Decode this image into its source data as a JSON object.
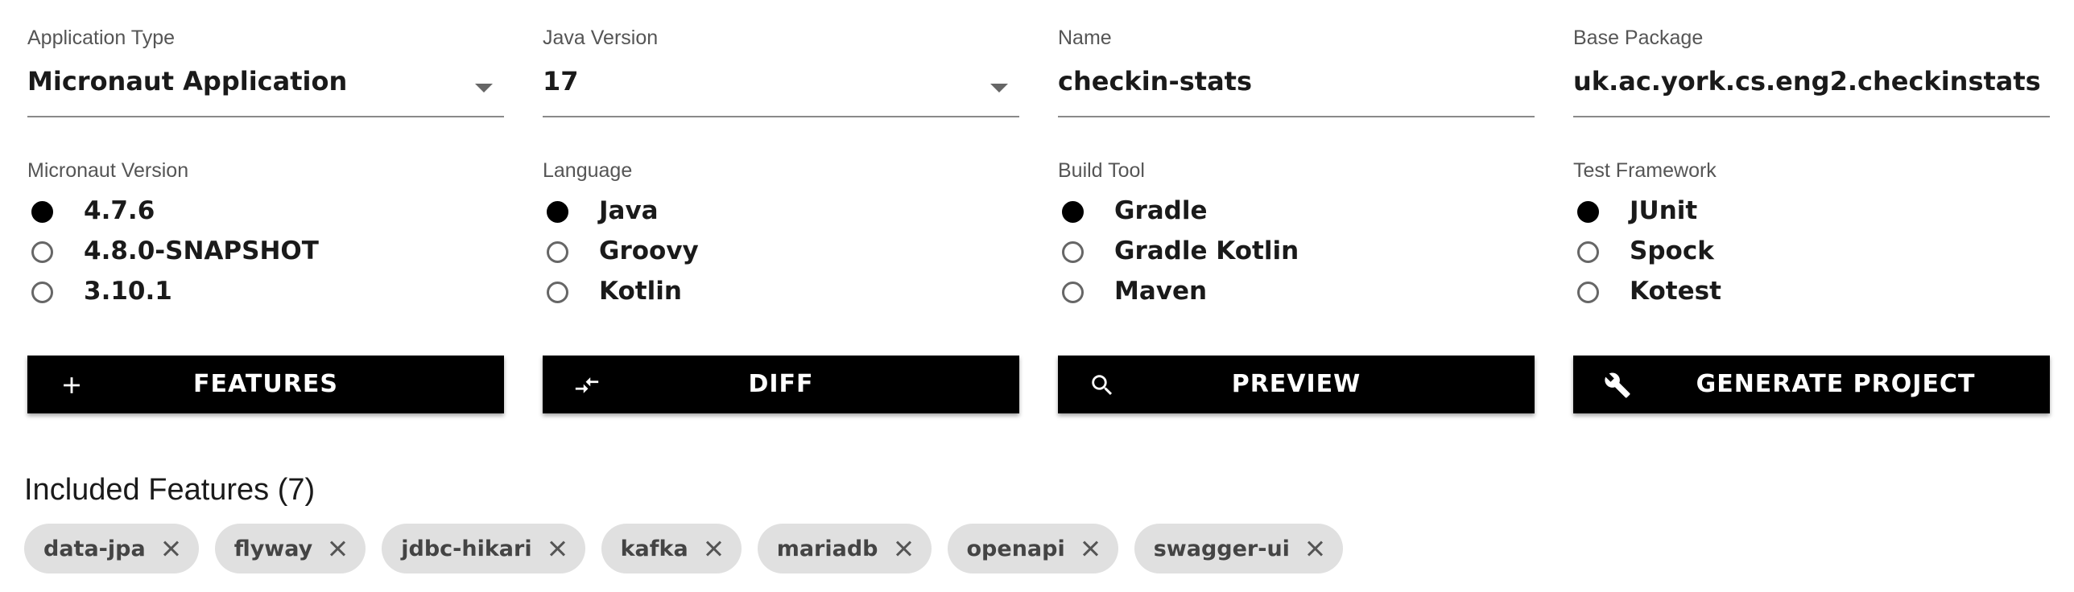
{
  "fields": {
    "application_type": {
      "label": "Application Type",
      "value": "Micronaut Application"
    },
    "java_version": {
      "label": "Java Version",
      "value": "17"
    },
    "name": {
      "label": "Name",
      "value": "checkin-stats"
    },
    "base_package": {
      "label": "Base Package",
      "value": "uk.ac.york.cs.eng2.checkinstats"
    }
  },
  "groups": {
    "micronaut_version": {
      "label": "Micronaut Version",
      "selected": "4.7.6",
      "options": [
        "4.7.6",
        "4.8.0-SNAPSHOT",
        "3.10.1"
      ]
    },
    "language": {
      "label": "Language",
      "selected": "Java",
      "options": [
        "Java",
        "Groovy",
        "Kotlin"
      ]
    },
    "build_tool": {
      "label": "Build Tool",
      "selected": "Gradle",
      "options": [
        "Gradle",
        "Gradle Kotlin",
        "Maven"
      ]
    },
    "test_framework": {
      "label": "Test Framework",
      "selected": "JUnit",
      "options": [
        "JUnit",
        "Spock",
        "Kotest"
      ]
    }
  },
  "actions": {
    "features": {
      "label": "FEATURES",
      "icon": "plus-icon"
    },
    "diff": {
      "label": "DIFF",
      "icon": "compare-arrows-icon"
    },
    "preview": {
      "label": "PREVIEW",
      "icon": "search-icon"
    },
    "generate": {
      "label": "GENERATE PROJECT",
      "icon": "wrench-icon"
    }
  },
  "included": {
    "title": "Included Features (7)",
    "features": [
      "data-jpa",
      "flyway",
      "jdbc-hikari",
      "kafka",
      "mariadb",
      "openapi",
      "swagger-ui"
    ]
  },
  "colors": {
    "button_bg": "#000000",
    "button_text": "#ffffff",
    "chip_bg": "#e0e0e0",
    "underline": "#8a8a8a"
  }
}
